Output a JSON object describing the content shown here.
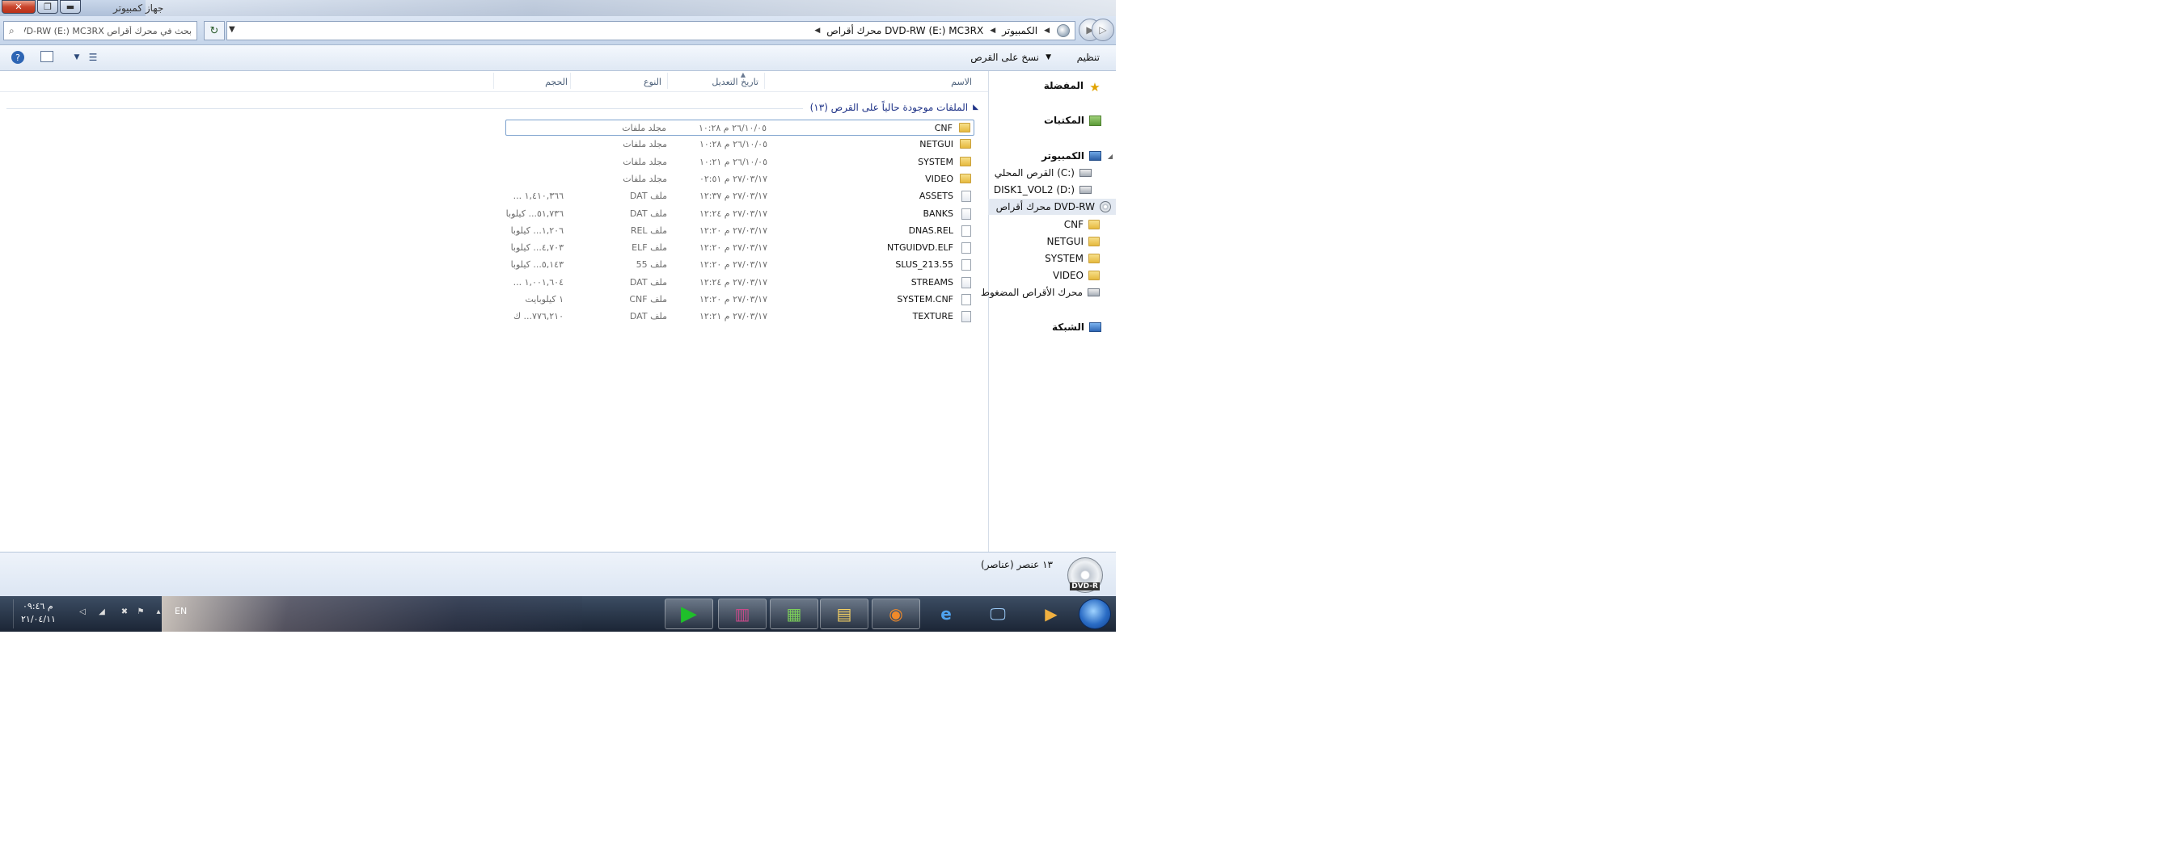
{
  "window": {
    "title": "جهاز كمبيوتر",
    "close_glyph": "✕",
    "max_glyph": "❐",
    "min_glyph": "▬"
  },
  "address": {
    "crumbs": [
      "الكمبيوتر",
      "محرك أقراص DVD-RW (E:) MC3RX"
    ],
    "search_placeholder": "بحث في محرك أقراص DVD-RW (E:) MC3RX",
    "refresh_glyph": "↻"
  },
  "toolbar": {
    "organize_label": "تنظيم",
    "burn_label": "نسخ على القرص"
  },
  "nav": {
    "favorites": "المفضلة",
    "libraries": "المكتبات",
    "computer": "الكمبيوتر",
    "drives": [
      "القرص المحلي (C:)",
      "DISK1_VOL2 (D:)",
      "محرك أقراص DVD-RW"
    ],
    "dvd_children": [
      "CNF",
      "NETGUI",
      "SYSTEM",
      "VIDEO"
    ],
    "compressed": "محرك الأقراص المضغوط",
    "network": "الشبكة"
  },
  "columns": {
    "name": "الاسم",
    "date": "تاريخ التعديل",
    "type": "النوع",
    "size": "الحجم"
  },
  "group": {
    "title": "الملفات موجودة حالياً على القرص (١٣)"
  },
  "files": [
    {
      "name": "CNF",
      "date": "٢٦/١٠/٠٥ م ١٠:٢٨",
      "type": "مجلد ملفات",
      "size": "",
      "kind": "folder"
    },
    {
      "name": "NETGUI",
      "date": "٢٦/١٠/٠٥ م ١٠:٢٨",
      "type": "مجلد ملفات",
      "size": "",
      "kind": "folder"
    },
    {
      "name": "SYSTEM",
      "date": "٢٦/١٠/٠٥ م ١٠:٢١",
      "type": "مجلد ملفات",
      "size": "",
      "kind": "folder"
    },
    {
      "name": "VIDEO",
      "date": "٢٧/٠٣/١٧ م ٠٢:٥١",
      "type": "مجلد ملفات",
      "size": "",
      "kind": "folder"
    },
    {
      "name": "ASSETS",
      "date": "٢٧/٠٣/١٧ م ١٢:٣٧",
      "type": "ملف DAT",
      "size": "١,٤١٠,٣٦٦ ...",
      "kind": "dat"
    },
    {
      "name": "BANKS",
      "date": "٢٧/٠٣/١٧ م ١٢:٢٤",
      "type": "ملف DAT",
      "size": "٥١,٧٣٦... كيلوبا",
      "kind": "dat"
    },
    {
      "name": "DNAS.REL",
      "date": "٢٧/٠٣/١٧ م ١٢:٢٠",
      "type": "ملف REL",
      "size": "١,٢٠٦... كيلوبا",
      "kind": "file"
    },
    {
      "name": "NTGUIDVD.ELF",
      "date": "٢٧/٠٣/١٧ م ١٢:٢٠",
      "type": "ملف ELF",
      "size": "٤,٧٠٣... كيلوبا",
      "kind": "file"
    },
    {
      "name": "SLUS_213.55",
      "date": "٢٧/٠٣/١٧ م ١٢:٢٠",
      "type": "ملف 55",
      "size": "٥,١٤٣... كيلوبا",
      "kind": "file"
    },
    {
      "name": "STREAMS",
      "date": "٢٧/٠٣/١٧ م ١٢:٢٤",
      "type": "ملف DAT",
      "size": "١,٠٠١,٦٠٤ ...",
      "kind": "dat"
    },
    {
      "name": "SYSTEM.CNF",
      "date": "٢٧/٠٣/١٧ م ١٢:٢٠",
      "type": "ملف CNF",
      "size": "١ كيلوبايت",
      "kind": "file"
    },
    {
      "name": "TEXTURE",
      "date": "٢٧/٠٣/١٧ م ١٢:٢١",
      "type": "ملف DAT",
      "size": "٧٧٦,٢١٠... ك",
      "kind": "dat"
    }
  ],
  "details": {
    "count": "١٣ عنصر (عناصر)",
    "icon_label": "DVD-R"
  },
  "taskbar": {
    "lang": "EN",
    "time": "م ٠٩:٤٦",
    "date": "٢١/٠٤/١١"
  },
  "colors": {
    "accent": "#1e3287",
    "titlebar": "#c9d7ea",
    "taskbar": "#1b2535"
  }
}
